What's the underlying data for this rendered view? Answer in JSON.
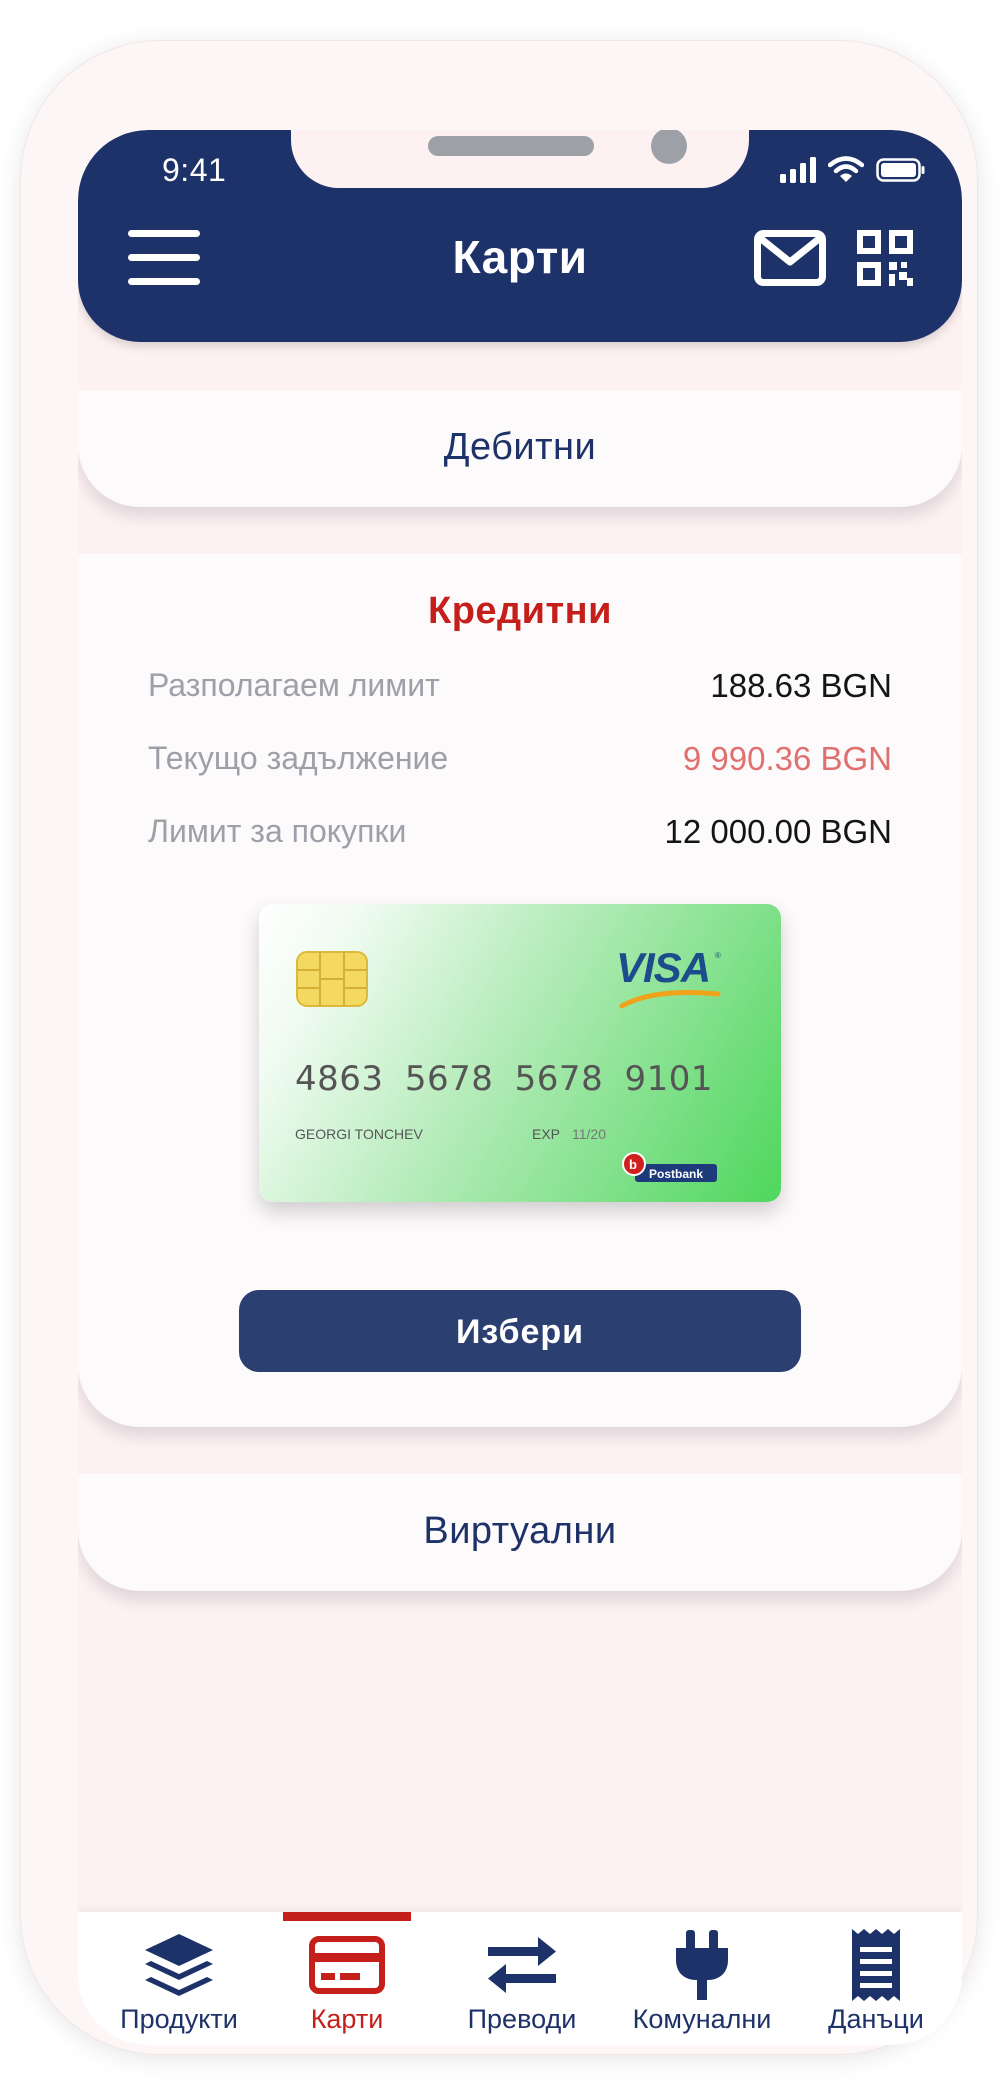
{
  "status_bar": {
    "time": "9:41"
  },
  "header": {
    "title": "Карти"
  },
  "sections": {
    "debit": {
      "title": "Дебитни"
    },
    "credit": {
      "title": "Кредитни",
      "rows": [
        {
          "label": "Разполагаем лимит",
          "value": "188.63 BGN"
        },
        {
          "label": "Текущо задължение",
          "value": "9 990.36 BGN"
        },
        {
          "label": "Лимит за покупки",
          "value": "12 000.00 BGN"
        }
      ],
      "card": {
        "number": "4863 5678 5678 9101",
        "holder": "GEORGI TONCHEV",
        "exp_label": "EXP",
        "exp_value": "11/20",
        "network": "VISA",
        "bank": "Postbank"
      },
      "select_label": "Избери"
    },
    "virtual": {
      "title": "Виртуални"
    }
  },
  "tabbar": {
    "items": [
      {
        "label": "Продукти",
        "icon": "layers-icon"
      },
      {
        "label": "Карти",
        "icon": "credit-card-icon"
      },
      {
        "label": "Преводи",
        "icon": "transfer-arrows-icon"
      },
      {
        "label": "Комунални",
        "icon": "plug-icon"
      },
      {
        "label": "Данъци",
        "icon": "receipt-icon"
      }
    ],
    "active": "Карти"
  },
  "colors": {
    "primary": "#1e326a",
    "accent": "#c41f1a",
    "negative_value": "#e07070",
    "background": "#fdf1f1"
  }
}
